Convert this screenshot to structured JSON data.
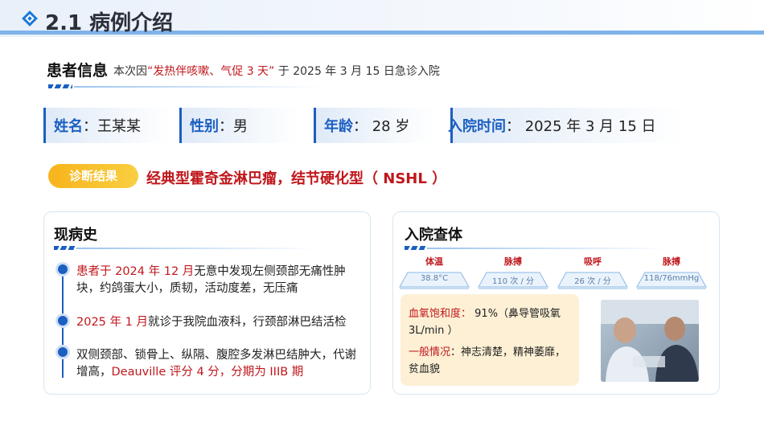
{
  "header": {
    "title": "2.1 病例介绍"
  },
  "patient": {
    "heading": "患者信息",
    "admit_prefix": "本次因",
    "admit_reason": "“发热伴咳嗽、气促 3 天”",
    "admit_suffix": " 于 2025 年 3 月 15 日急诊入院"
  },
  "info": {
    "name_label": "姓名",
    "name_value": "：王某某",
    "sex_label": "性别",
    "sex_value": "：男",
    "age_label": "年龄",
    "age_value": "： 28 岁",
    "date_label": "入院时间",
    "date_value": "：  2025 年 3 月 15 日"
  },
  "diagnosis": {
    "badge": "诊断结果",
    "text": "经典型霍奇金淋巴瘤，结节硬化型（ NSHL ）"
  },
  "history": {
    "title": "现病史",
    "item1_red": "患者于 2024 年 12 月",
    "item1_rest": "无意中发现左侧颈部无痛性肿块，约鸽蛋大小，质韧，活动度差，无压痛",
    "item2_red": "2025 年 1 月",
    "item2_rest": "就诊于我院血液科，行颈部淋巴结活检",
    "item3_rest": "双侧颈部、锁骨上、纵隔、腹腔多发淋巴结肿大，代谢增高，",
    "item3_red": "Deauville 评分 4 分，分期为 IIIB 期"
  },
  "exam": {
    "title": "入院查体",
    "vitals": [
      {
        "label": "体温",
        "value": "38.8°C"
      },
      {
        "label": "脉搏",
        "value": "110 次 / 分"
      },
      {
        "label": "吸呼",
        "value": "26 次 / 分"
      },
      {
        "label": "脉搏",
        "value": "118/76mmHg"
      }
    ],
    "spo2_label": "血氧饱和度：",
    "spo2_value": " 91%（鼻导管吸氧 3L/min ）",
    "general_label": "一般情况",
    "general_value": "：神志清楚，精神萎靡，贫血貌"
  },
  "colors": {
    "accent": "#1b5fc1",
    "red": "#c0171c",
    "badge": "#f7b41c",
    "vital_box": "#fdf0d5"
  }
}
